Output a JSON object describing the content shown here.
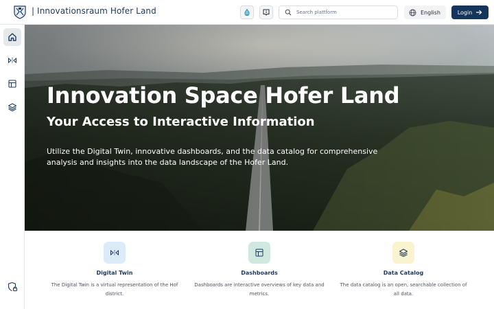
{
  "header": {
    "title": "| Innovationsraum Hofer Land",
    "search_placeholder": "Search plattform",
    "language": "English",
    "login_label": "Login"
  },
  "icons": {
    "logo": "coat-of-arms-icon",
    "water": "water-drop-icon",
    "info": "info-box-icon",
    "search": "search-icon",
    "globe": "globe-icon",
    "arrow": "arrow-right-icon"
  },
  "sidebar": {
    "items": [
      {
        "name": "home",
        "icon": "home-icon",
        "active": true
      },
      {
        "name": "digital-twin",
        "icon": "digital-twin-icon",
        "active": false
      },
      {
        "name": "dashboards",
        "icon": "dashboard-layout-icon",
        "active": false
      },
      {
        "name": "data-catalog",
        "icon": "layers-icon",
        "active": false
      }
    ],
    "bottom_icon": "privacy-shield-icon"
  },
  "hero": {
    "title": "Innovation Space Hofer Land",
    "subtitle": "Your Access to Interactive Information",
    "description": "Utilize the Digital Twin, innovative dashboards, and the data catalog for comprehensive analysis and insights into the data landscape of the Hofer Land."
  },
  "features": [
    {
      "title": "Digital Twin",
      "description": "The Digital Twin is a virtual representation of the Hof district.",
      "icon": "digital-twin-icon",
      "color": "#dcebf8"
    },
    {
      "title": "Dashboards",
      "description": "Dashboards are interactive overviews of key data and metrics.",
      "icon": "dashboard-layout-icon",
      "color": "#cfe9e1"
    },
    {
      "title": "Data Catalog",
      "description": "The data catalog is an open, searchable collection of all data.",
      "icon": "layers-icon",
      "color": "#faf3cf"
    }
  ],
  "colors": {
    "brand": "#15355a",
    "title": "#1e3a5f"
  }
}
